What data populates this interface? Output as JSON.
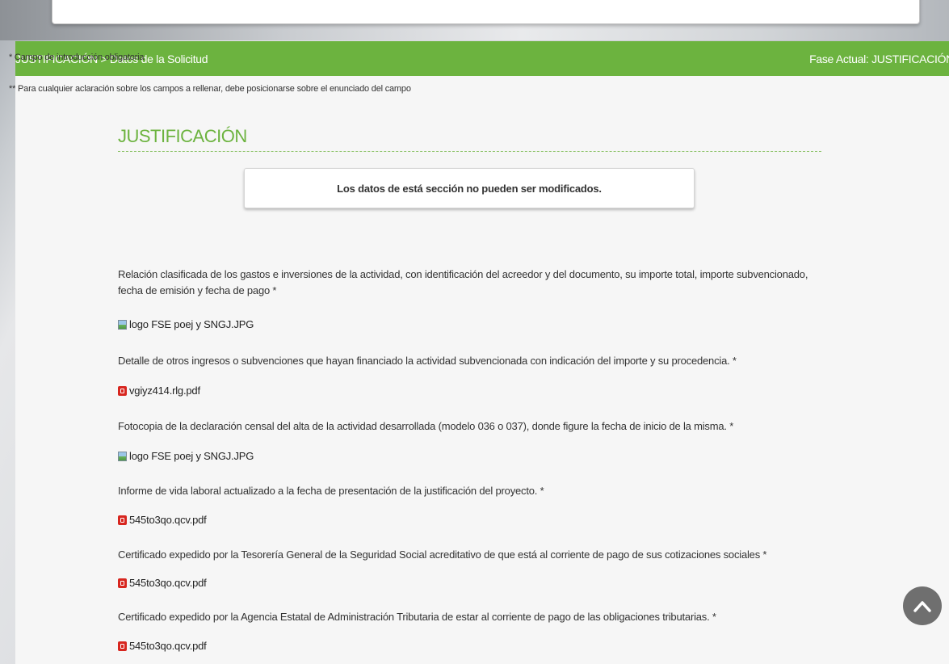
{
  "header": {
    "breadcrumb": "JUSTIFICACIÓN > Datos de la Solicitud",
    "phase": "Fase Actual: JUSTIFICACIÓN"
  },
  "notes": {
    "required": "* Campo de introducción obligatoria",
    "help": "** Para cualquier aclaración sobre los campos a rellenar, debe posicionarse sobre el enunciado del campo"
  },
  "section": {
    "title": "JUSTIFICACIÓN",
    "info_message": "Los datos de está sección no pueden ser modificados."
  },
  "fields": [
    {
      "label": "Relación clasificada de los gastos e inversiones de la actividad, con identificación del acreedor y del documento, su importe total, importe subvencionado, fecha de emisión y fecha de pago *",
      "file": "logo FSE poej y SNGJ.JPG",
      "file_type": "image"
    },
    {
      "label": "Detalle de otros ingresos o subvenciones que hayan financiado la actividad subvencionada con indicación del importe y su procedencia. *",
      "file": "vgiyz414.rlg.pdf",
      "file_type": "pdf"
    },
    {
      "label": "Fotocopia de la declaración censal del alta de la actividad desarrollada (modelo 036 o 037), donde figure la fecha de inicio de la misma. *",
      "file": "logo FSE poej y SNGJ.JPG",
      "file_type": "image"
    },
    {
      "label": "Informe de vida laboral actualizado a la fecha de presentación de la justificación del proyecto. *",
      "file": "545to3qo.qcv.pdf",
      "file_type": "pdf"
    },
    {
      "label": "Certificado expedido por la Tesorería General de la Seguridad Social acreditativo de que está al corriente de pago de sus cotizaciones sociales *",
      "file": "545to3qo.qcv.pdf",
      "file_type": "pdf"
    },
    {
      "label": "Certificado expedido por la Agencia Estatal de Administración Tributaria de estar al corriente de pago de las obligaciones tributarias. *",
      "file": "545to3qo.qcv.pdf",
      "file_type": "pdf"
    }
  ],
  "icons": {
    "image_file": "image-file-icon",
    "pdf_file": "pdf-file-icon",
    "scroll_top": "chevron-up-icon"
  },
  "colors": {
    "accent_green": "#6cb33f",
    "pdf_red": "#d7261f",
    "scroll_button": "#6f6f6f"
  }
}
